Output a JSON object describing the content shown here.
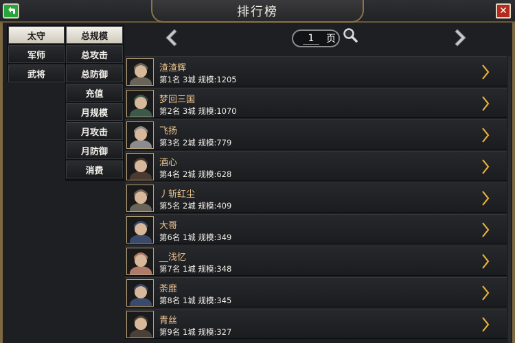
{
  "header": {
    "title": "排行榜"
  },
  "categories": [
    {
      "label": "太守",
      "active": true
    },
    {
      "label": "军师",
      "active": false
    },
    {
      "label": "武将",
      "active": false
    }
  ],
  "subcategories": [
    {
      "label": "总规模",
      "active": true
    },
    {
      "label": "总攻击",
      "active": false
    },
    {
      "label": "总防御",
      "active": false
    },
    {
      "label": "充值",
      "active": false
    },
    {
      "label": "月规模",
      "active": false
    },
    {
      "label": "月攻击",
      "active": false
    },
    {
      "label": "月防御",
      "active": false
    },
    {
      "label": "消费",
      "active": false
    }
  ],
  "pagination": {
    "page": "1",
    "unit": "页"
  },
  "rankings": [
    {
      "name": "渣渣辉",
      "info": "第1名 3城 规模:1205",
      "avatar_color": "#6a6458"
    },
    {
      "name": "梦回三国",
      "info": "第2名 3城 规模:1070",
      "avatar_color": "#3c5a4a"
    },
    {
      "name": "飞扬",
      "info": "第3名 2城 规模:779",
      "avatar_color": "#8a8c90"
    },
    {
      "name": "酒心",
      "info": "第4名 2城 规模:628",
      "avatar_color": "#4a3a30"
    },
    {
      "name": "丿斩红尘",
      "info": "第5名 2城 规模:409",
      "avatar_color": "#6a6458"
    },
    {
      "name": "大哥",
      "info": "第6名 1城 规模:349",
      "avatar_color": "#3c4a6a"
    },
    {
      "name": "__浅忆",
      "info": "第7名 1城 规模:348",
      "avatar_color": "#b07a6a"
    },
    {
      "name": "荼靡",
      "info": "第8名 1城 规模:345",
      "avatar_color": "#3a4a6a"
    },
    {
      "name": "青丝",
      "info": "第9名 1城 规模:327",
      "avatar_color": "#4a4038"
    }
  ],
  "colors": {
    "accent_gold": "#f0c890",
    "frame_gold": "#7d6841",
    "back_green": "#27a53a",
    "close_red": "#b42a20"
  },
  "icons": {
    "back": "back-arrow-icon",
    "close": "close-x-icon",
    "prev": "prev-arrow-icon",
    "next": "next-arrow-icon",
    "search": "magnifier-icon",
    "row_arrow": "chevron-right-icon"
  }
}
